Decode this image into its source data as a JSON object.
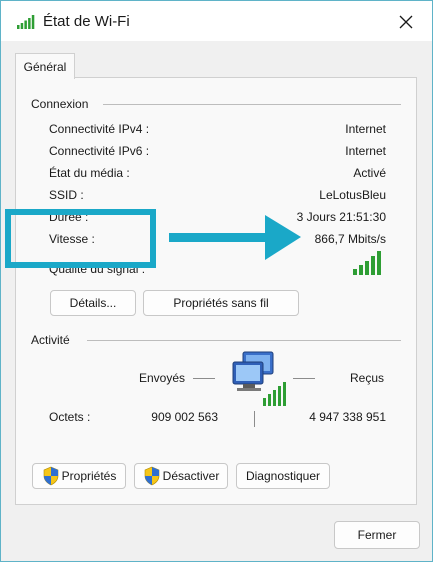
{
  "window": {
    "title": "État de Wi-Fi"
  },
  "tabs": [
    {
      "label": "Général"
    }
  ],
  "connexion": {
    "title": "Connexion",
    "rows": [
      {
        "label": "Connectivité IPv4 :",
        "value": "Internet"
      },
      {
        "label": "Connectivité IPv6 :",
        "value": "Internet"
      },
      {
        "label": "État du média :",
        "value": "Activé"
      },
      {
        "label": "SSID :",
        "value": "LeLotusBleu"
      },
      {
        "label": "Durée :",
        "value": "3 Jours 21:51:30"
      },
      {
        "label": "Vitesse :",
        "value": "866,7 Mbits/s"
      },
      {
        "label": "Qualité du signal :"
      }
    ],
    "signal_bars": 5,
    "buttons": {
      "details": "Détails...",
      "wireless_props": "Propriétés sans fil"
    }
  },
  "activite": {
    "title": "Activité",
    "sent_label": "Envoyés",
    "received_label": "Reçus",
    "octets_label": "Octets :",
    "sent_value": "909 002 563",
    "received_value": "4 947 338 951"
  },
  "bottom_buttons": {
    "properties": "Propriétés",
    "disable": "Désactiver",
    "diagnose": "Diagnostiquer"
  },
  "footer": {
    "close": "Fermer"
  },
  "colors": {
    "accent": "#1aa8c8",
    "signal": "#2e9e34",
    "window_border": "#5fb3c8"
  }
}
